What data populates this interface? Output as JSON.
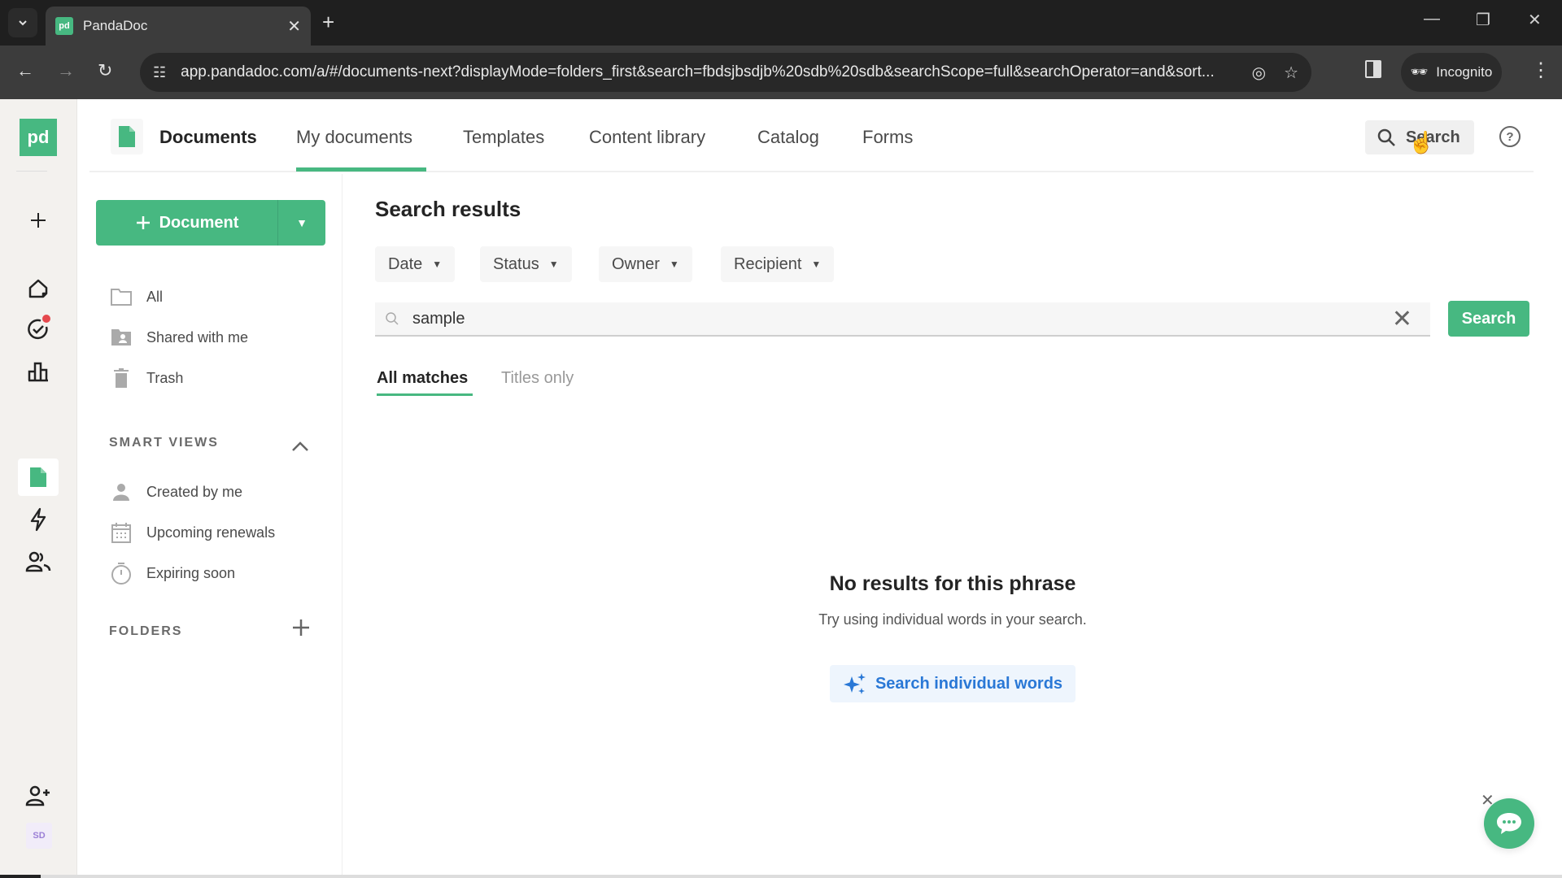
{
  "browser": {
    "tab_title": "PandaDoc",
    "favicon_text": "pd",
    "url": "app.pandadoc.com/a/#/documents-next?displayMode=folders_first&search=fbdsjbsdjb%20sdb%20sdb&searchScope=full&searchOperator=and&sort...",
    "incognito_label": "Incognito"
  },
  "rail": {
    "logo_text": "pd",
    "avatar_initials": "SD",
    "items": [
      "create",
      "home",
      "tasks",
      "reports",
      "documents",
      "automations",
      "contacts",
      "invite-user"
    ]
  },
  "header": {
    "title": "Documents",
    "tabs": [
      {
        "label": "My documents",
        "active": true
      },
      {
        "label": "Templates",
        "active": false
      },
      {
        "label": "Content library",
        "active": false
      },
      {
        "label": "Catalog",
        "active": false
      },
      {
        "label": "Forms",
        "active": false
      }
    ],
    "search_label": "Search",
    "help_glyph": "?"
  },
  "sidebar": {
    "new_document_label": "Document",
    "items": [
      {
        "label": "All",
        "icon": "folder-icon"
      },
      {
        "label": "Shared with me",
        "icon": "shared-folder-icon"
      },
      {
        "label": "Trash",
        "icon": "trash-icon"
      }
    ],
    "smart_views_label": "SMART VIEWS",
    "smart_views": [
      {
        "label": "Created by me",
        "icon": "person-icon"
      },
      {
        "label": "Upcoming renewals",
        "icon": "calendar-icon"
      },
      {
        "label": "Expiring soon",
        "icon": "timer-icon"
      }
    ],
    "folders_label": "FOLDERS"
  },
  "main": {
    "title": "Search results",
    "filters": [
      {
        "label": "Date"
      },
      {
        "label": "Status"
      },
      {
        "label": "Owner"
      },
      {
        "label": "Recipient"
      }
    ],
    "search_value": "sample",
    "search_button": "Search",
    "sub_tabs": [
      {
        "label": "All matches",
        "active": true
      },
      {
        "label": "Titles only",
        "active": false
      }
    ],
    "empty_title": "No results for this phrase",
    "empty_subtitle": "Try using individual words in your search.",
    "individual_words_button": "Search individual words"
  },
  "colors": {
    "brand_green": "#47b881",
    "link_blue": "#2a78d6",
    "notification_red": "#e5484d"
  }
}
